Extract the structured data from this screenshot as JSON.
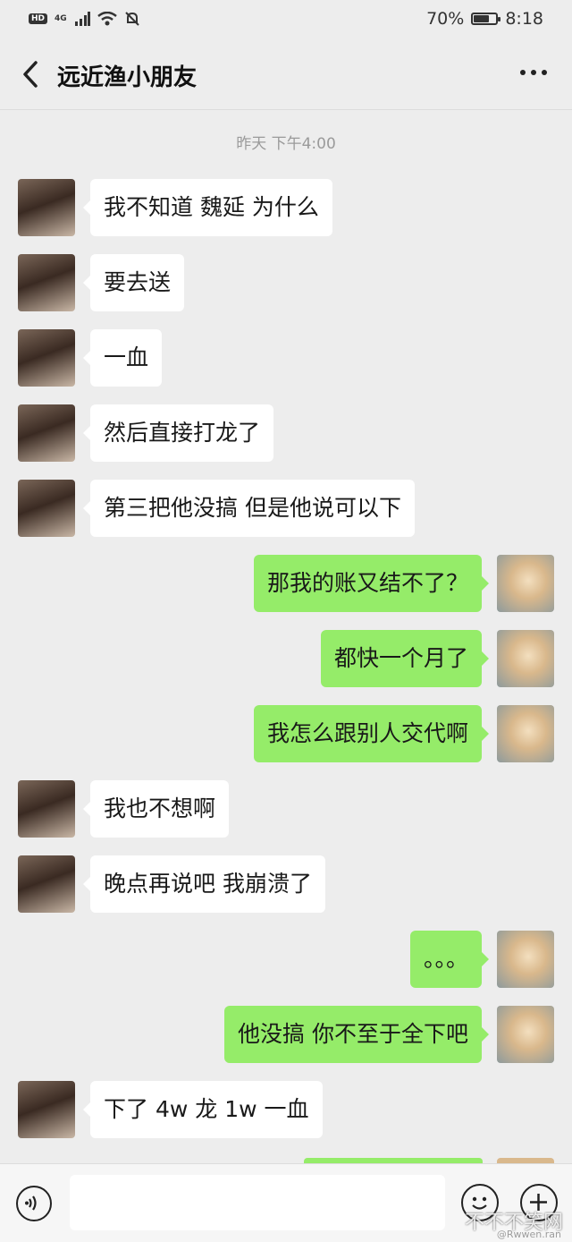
{
  "status_bar": {
    "hd": "HD",
    "network": "4G",
    "battery_percent": "70%",
    "battery_level": 0.7,
    "time": "8:18"
  },
  "header": {
    "title": "远近渔小朋友"
  },
  "chat": {
    "timestamp": "昨天 下午4:00",
    "messages": [
      {
        "side": "left",
        "text": "我不知道 魏延 为什么"
      },
      {
        "side": "left",
        "text": "要去送"
      },
      {
        "side": "left",
        "text": "一血"
      },
      {
        "side": "left",
        "text": "然后直接打龙了"
      },
      {
        "side": "left",
        "text": "第三把他没搞 但是他说可以下"
      },
      {
        "side": "right",
        "text": "那我的账又结不了？"
      },
      {
        "side": "right",
        "text": "都快一个月了"
      },
      {
        "side": "right",
        "text": "我怎么跟别人交代啊"
      },
      {
        "side": "left",
        "text": "我也不想啊"
      },
      {
        "side": "left",
        "text": "晚点再说吧 我崩溃了"
      },
      {
        "side": "right",
        "text": "。。。"
      },
      {
        "side": "right",
        "text": "他没搞  你不至于全下吧"
      },
      {
        "side": "left",
        "text": "下了 4w 龙 1w 一血"
      }
    ]
  },
  "input_bar": {
    "placeholder": ""
  },
  "watermark": {
    "text": "不不不笑网",
    "sub": "@Rwwen.ran"
  },
  "colors": {
    "background": "#ededed",
    "bubble_self": "#95ec69",
    "bubble_other": "#ffffff"
  }
}
